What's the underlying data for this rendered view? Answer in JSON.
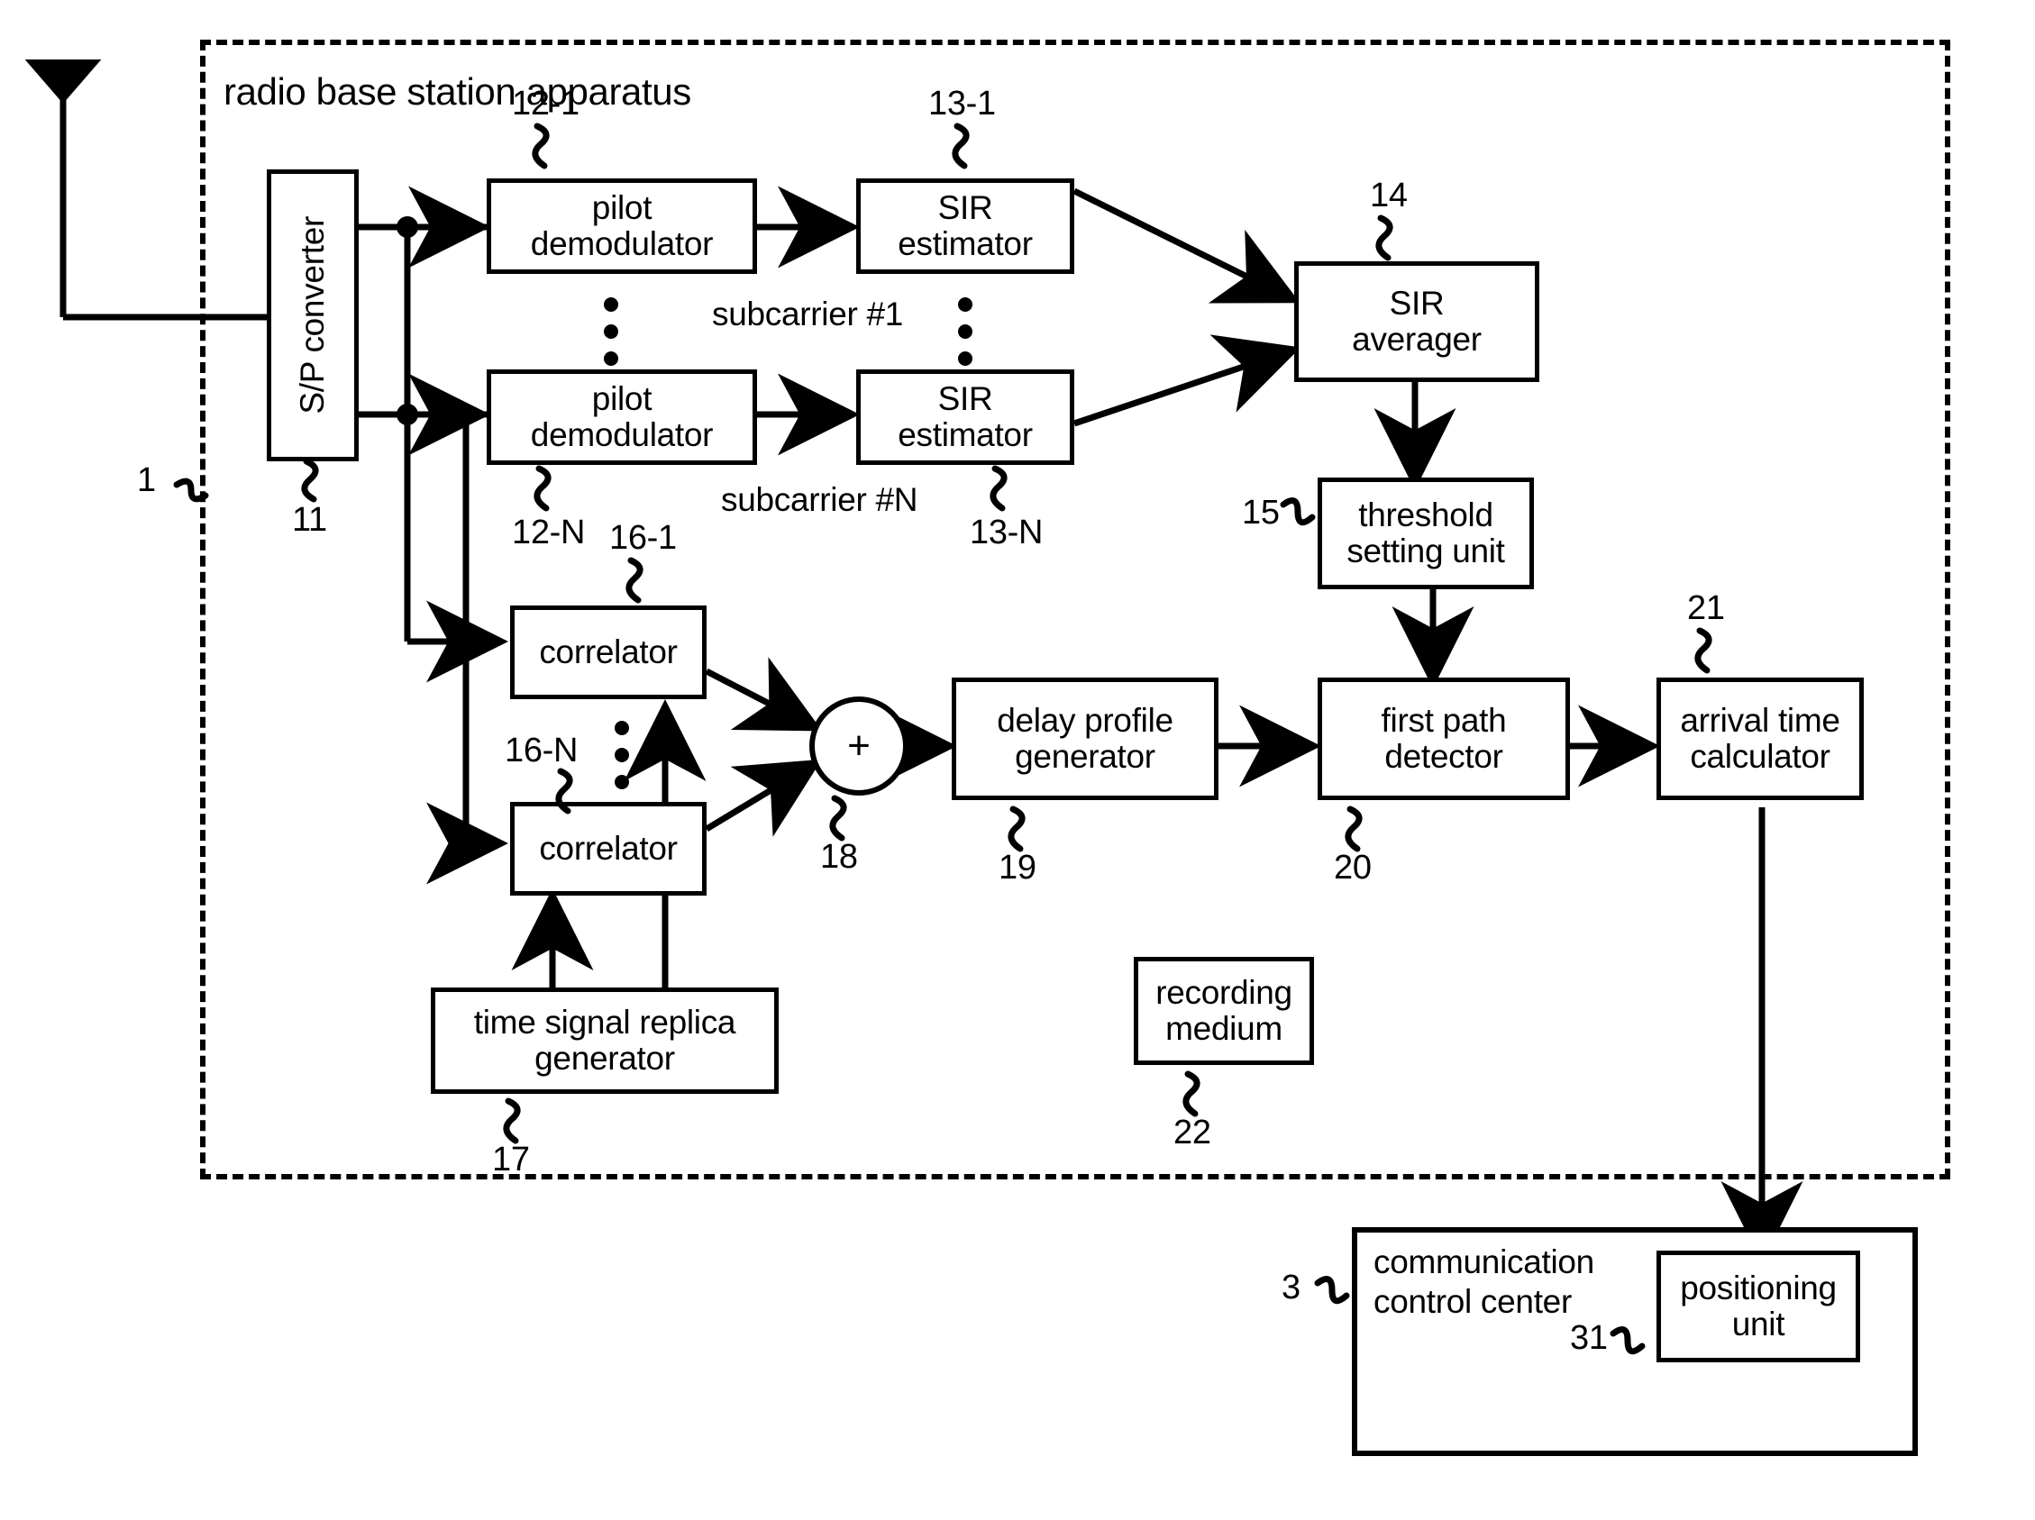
{
  "figure": {
    "type": "block-diagram",
    "enclosure_title": "radio base station apparatus",
    "enclosure_ref": "1"
  },
  "blocks": {
    "sp_converter": {
      "label": "S/P converter",
      "ref": "11"
    },
    "pilot_demod_1": {
      "line1": "pilot",
      "line2": "demodulator",
      "ref": "12-1"
    },
    "pilot_demod_n": {
      "line1": "pilot",
      "line2": "demodulator",
      "ref": "12-N"
    },
    "sir_estimator_1": {
      "line1": "SIR",
      "line2": "estimator",
      "ref": "13-1"
    },
    "sir_estimator_n": {
      "line1": "SIR",
      "line2": "estimator",
      "ref": "13-N"
    },
    "sir_averager": {
      "line1": "SIR",
      "line2": "averager",
      "ref": "14"
    },
    "threshold_setting_unit": {
      "line1": "threshold",
      "line2": "setting unit",
      "ref": "15"
    },
    "correlator_1": {
      "label": "correlator",
      "ref": "16-1"
    },
    "correlator_n": {
      "label": "correlator",
      "ref": "16-N"
    },
    "time_signal_replica_generator": {
      "line1": "time signal replica",
      "line2": "generator",
      "ref": "17"
    },
    "adder": {
      "symbol": "+",
      "ref": "18"
    },
    "delay_profile_generator": {
      "line1": "delay profile",
      "line2": "generator",
      "ref": "19"
    },
    "first_path_detector": {
      "line1": "first path",
      "line2": "detector",
      "ref": "20"
    },
    "arrival_time_calculator": {
      "line1": "arrival time",
      "line2": "calculator",
      "ref": "21"
    },
    "recording_medium": {
      "line1": "recording",
      "line2": "medium",
      "ref": "22"
    },
    "communication_control_center": {
      "line1": "communication",
      "line2": "control center",
      "ref": "3"
    },
    "positioning_unit": {
      "line1": "positioning",
      "line2": "unit",
      "ref": "31"
    }
  },
  "annotations": {
    "subcarrier_first": "subcarrier #1",
    "subcarrier_last": "subcarrier #N"
  },
  "colors": {
    "line": "#000000",
    "background": "#ffffff"
  }
}
